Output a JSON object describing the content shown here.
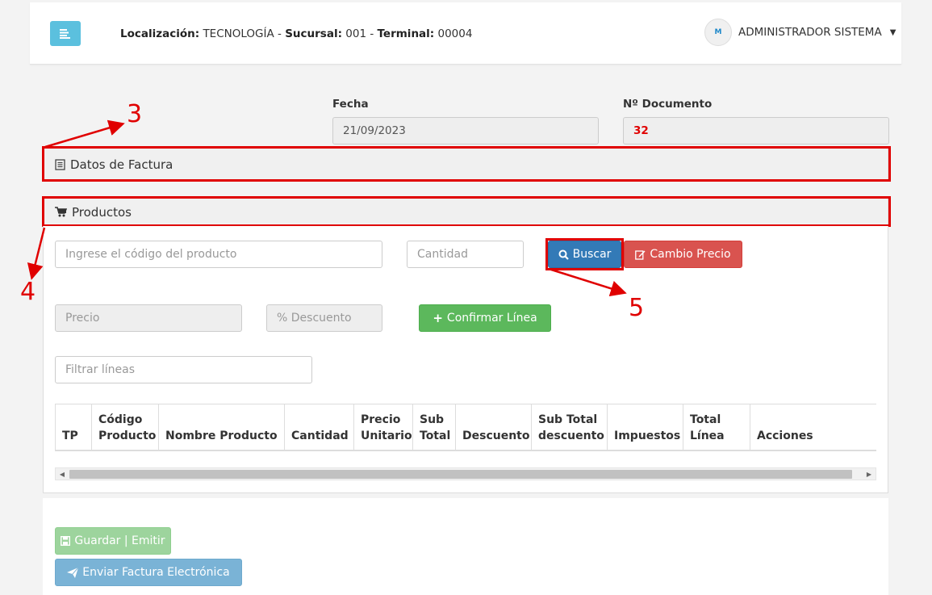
{
  "header": {
    "loc_label": "Localización:",
    "loc_value": "TECNOLOGÍA",
    "suc_label": "Sucursal:",
    "suc_value": "001",
    "term_label": "Terminal:",
    "term_value": "00004",
    "separator": "-",
    "user_name": "ADMINISTRADOR SISTEMA",
    "avatar_text": "M"
  },
  "fecha": {
    "label": "Fecha",
    "value": "21/09/2023"
  },
  "documento": {
    "label": "Nº Documento",
    "value": "32"
  },
  "sections": {
    "datos_factura": "Datos de Factura",
    "productos": "Productos"
  },
  "inputs": {
    "codigo_placeholder": "Ingrese el código del producto",
    "cantidad_placeholder": "Cantidad",
    "precio_placeholder": "Precio",
    "descuento_placeholder": "% Descuento",
    "filtrar_placeholder": "Filtrar líneas"
  },
  "buttons": {
    "buscar": "Buscar",
    "cambio_precio": "Cambio Precio",
    "confirmar": "Confirmar Línea",
    "guardar": "Guardar | Emitir",
    "enviar": "Enviar Factura Electrónica"
  },
  "table": {
    "columns": [
      [
        "TP"
      ],
      [
        "Código",
        "Producto"
      ],
      [
        "Nombre Producto"
      ],
      [
        "Cantidad"
      ],
      [
        "Precio",
        "Unitario"
      ],
      [
        "Sub",
        "Total"
      ],
      [
        "Descuento"
      ],
      [
        "Sub Total",
        "descuento"
      ],
      [
        "Impuestos"
      ],
      [
        "Total",
        "Línea"
      ],
      [
        "Acciones"
      ]
    ]
  },
  "annotations": [
    "3",
    "4",
    "5"
  ],
  "colors": {
    "annotation": "#e00000",
    "primary": "#337ab7",
    "danger": "#d9534f",
    "success": "#5cb85c",
    "menu": "#5bc0de"
  }
}
